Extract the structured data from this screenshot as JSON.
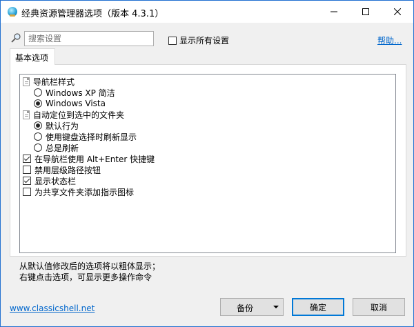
{
  "window": {
    "title": "经典资源管理器选项（版本 4.3.1）"
  },
  "search": {
    "placeholder": "搜索设置"
  },
  "show_all": {
    "label": "显示所有设置",
    "checked": false
  },
  "help": {
    "label": "帮助..."
  },
  "tabs": [
    {
      "label": "基本选项",
      "active": true
    }
  ],
  "tree": {
    "groups": [
      {
        "label": "导航栏样式",
        "options": [
          {
            "label": "Windows XP 简洁",
            "selected": false
          },
          {
            "label": "Windows Vista",
            "selected": true
          }
        ]
      },
      {
        "label": "自动定位到选中的文件夹",
        "options": [
          {
            "label": "默认行为",
            "selected": true
          },
          {
            "label": "使用键盘选择时刷新显示",
            "selected": false
          },
          {
            "label": "总是刷新",
            "selected": false
          }
        ]
      }
    ],
    "checkboxes": [
      {
        "label": "在导航栏使用 Alt+Enter 快捷键",
        "checked": true
      },
      {
        "label": "禁用层级路径按钮",
        "checked": false
      },
      {
        "label": "显示状态栏",
        "checked": true
      },
      {
        "label": "为共享文件夹添加指示图标",
        "checked": false
      }
    ]
  },
  "note": {
    "line1": "从默认值修改后的选项将以粗体显示；",
    "line2": "右键点击选项，可显示更多操作命令"
  },
  "footer": {
    "link": "www.classicshell.net",
    "backup_label": "备份",
    "ok_label": "确定",
    "cancel_label": "取消"
  }
}
